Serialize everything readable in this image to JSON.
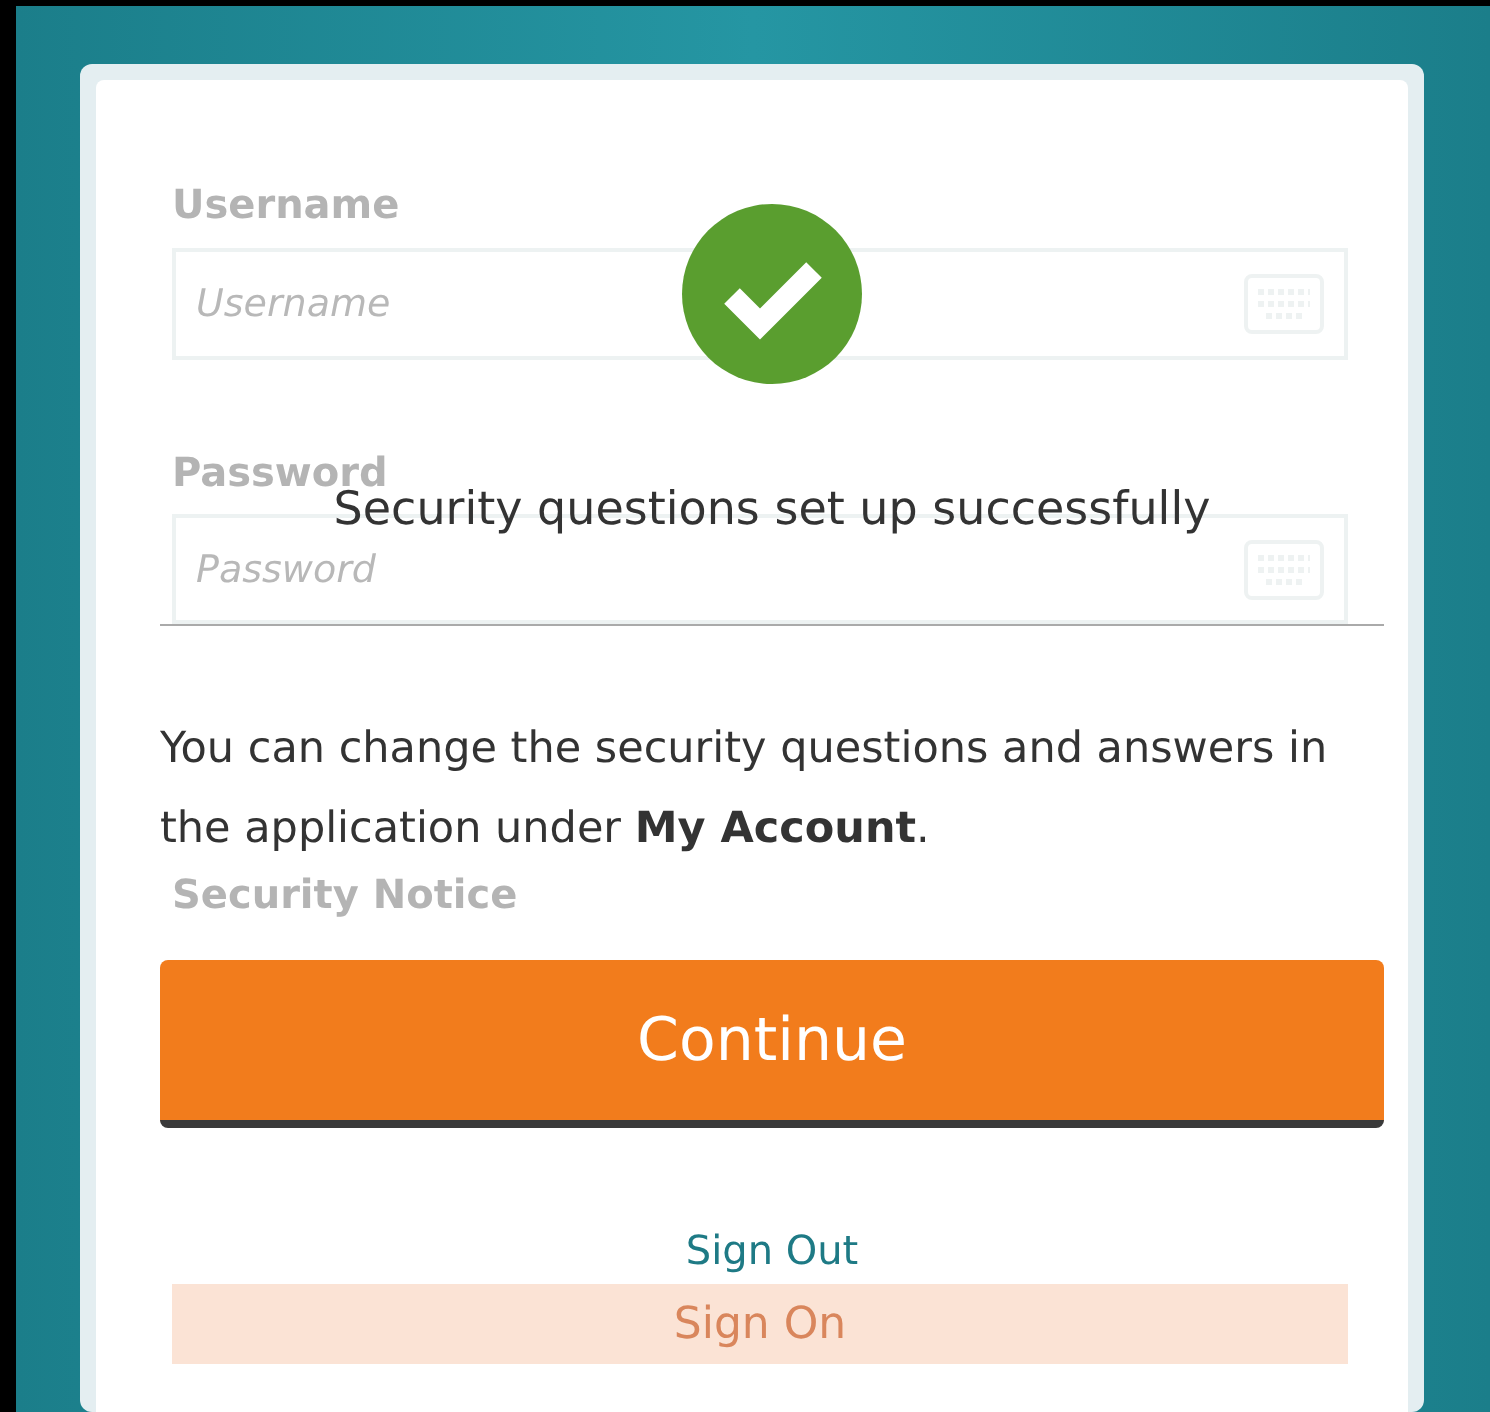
{
  "background_form": {
    "username_label": "Username",
    "username_field": {
      "placeholder": "Username"
    },
    "password_label": "Password",
    "password_field": {
      "placeholder": "Password"
    },
    "security_notice_title": "Security Notice",
    "sign_on_button": "Sign On"
  },
  "dialog": {
    "title": "Security questions set up successfully",
    "message": "You can change the security questions and answers in the application under **My Account**.",
    "continue_button": "Continue",
    "sign_out_link": "Sign Out"
  }
}
